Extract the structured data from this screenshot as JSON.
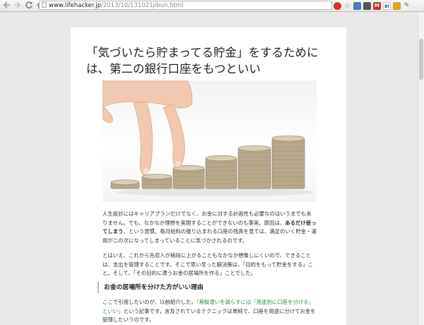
{
  "browser": {
    "back_icon": "back-arrow-icon",
    "forward_icon": "forward-arrow-icon",
    "reload_icon": "reload-icon",
    "home_icon": "home-icon",
    "url_host": "www.lifehacker.jp",
    "url_path": "/2013/10/131021jibun.html",
    "extensions": [
      {
        "name": "stop-red-icon",
        "label": "",
        "color": "#d9302a"
      },
      {
        "name": "star-icon",
        "label": "☆",
        "color": "#ffffff"
      },
      {
        "name": "page-icon",
        "label": "",
        "color": "#4a78c2"
      },
      {
        "name": "camera-icon",
        "label": "",
        "color": "#555555"
      },
      {
        "name": "gmail-icon",
        "label": "M",
        "color": "#c8322a"
      },
      {
        "name": "bl-icon",
        "label": "Bl",
        "color": "#ffffff"
      },
      {
        "name": "zip-icon",
        "label": "",
        "color": "#e3a21f"
      },
      {
        "name": "wrench-icon",
        "label": "",
        "color": "#666666"
      }
    ]
  },
  "article": {
    "title": "「気づいたら貯まってる貯金」をするためには、第二の銀行口座をもつといい",
    "hero_image": "hand-walking-on-coin-stacks",
    "paragraph1_a": "人生設計にはキャリアプランだけでなく、お金に対する計画性も必要なのはいうまでもありません。でも、なかなか理想を実現することができないのも事実。原因は、",
    "paragraph1_bold": "あるだけ使ってしまう",
    "paragraph1_b": "、という習慣。毎月給料の振り込まれる口座の残高を見ては、満足のいく貯金・運用が二の次になってしまっていることに気づかされるのです。",
    "paragraph2": "とはいえ、これから先収入が格段に上がることもなかなか想像しにくいので、できることは、支出を管理することです。そこで思い至った解決策は、「目的をもって貯金をする」こと。そして、「その目的に適うお金の居場所を作る」ことでした。",
    "subheading": "お金の居場所を分けた方がいい理由",
    "paragraph3_a": "ここで引用したいのが、以前紹介した、",
    "paragraph3_link": "「無駄遣いを減らすには『用途別に口座を分ける』といい」",
    "paragraph3_b": "という記事です。言及されているテクニックは単純で、口座を用途に分けてお金を管理したいうのです。"
  }
}
